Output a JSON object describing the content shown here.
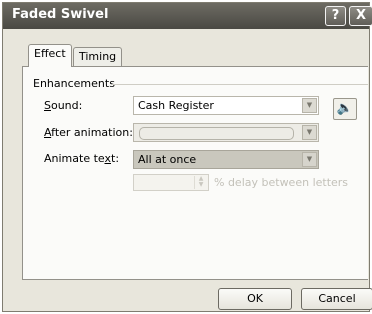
{
  "dialog": {
    "title": "Faded Swivel",
    "help_button": "?",
    "close_button": "X"
  },
  "tabs": [
    {
      "label": "Effect",
      "selected": true
    },
    {
      "label": "Timing",
      "selected": false
    }
  ],
  "enhancements": {
    "group_label": "Enhancements",
    "sound": {
      "label_u": "S",
      "label_rest": "ound:",
      "value": "Cash Register"
    },
    "after_animation": {
      "label_u": "A",
      "label_rest": "fter animation:",
      "value": ""
    },
    "animate_text": {
      "label_pre": "Animate te",
      "label_u": "x",
      "label_rest": "t:",
      "value": "All at once"
    },
    "delay": {
      "value": "",
      "label": "% delay between letters"
    }
  },
  "buttons": {
    "ok": "OK",
    "cancel": "Cancel"
  }
}
